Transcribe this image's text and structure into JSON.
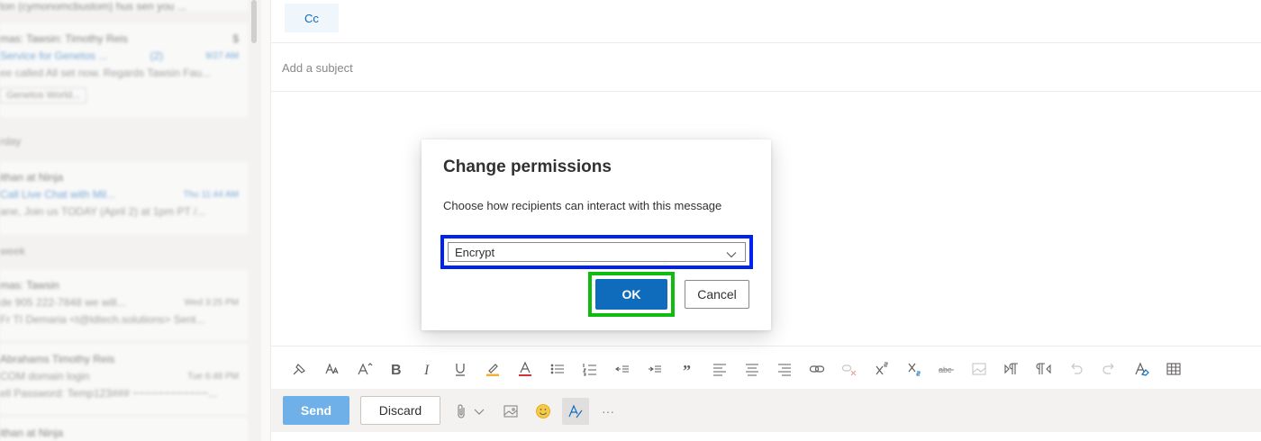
{
  "mail_list": {
    "items": [
      {
        "sender": "ton (cymonomcbustom) hus sen you ...",
        "subject": "",
        "preview": "",
        "time": ""
      },
      {
        "sender": "mas: Tawsin: Timothy Reis",
        "subject": "Service for Genetos ...",
        "preview": "ee called All set now. Regards Tawsin Fau...",
        "time": "9/27 AM",
        "count": "(2)",
        "chip": "Genetos World..."
      },
      {
        "sender": "ithan at Ninja",
        "subject": "Call Live Chat with Mil...",
        "preview": "ane, Join us TODAY (April 2) at 1pm PT /...",
        "time": "Thu 11:44 AM"
      },
      {
        "sender": "mas: Tawsin",
        "subject": "de 905 222-7848 we will...",
        "preview": "Fr TI Demaria <t@ldtech.solutions> Sent...",
        "time": "Wed 3:25 PM"
      },
      {
        "sender": "Abrahams Timothy Reis",
        "subject": "COM domain login",
        "preview": "ell Password: Temp123### ~~~~~~~~~~~~...",
        "time": "Tue 6:48 PM"
      },
      {
        "sender": "ithan at Ninja",
        "subject": "",
        "preview": "",
        "time": ""
      }
    ],
    "groups": [
      "rday",
      "week"
    ]
  },
  "compose": {
    "cc_label": "Cc",
    "subject_placeholder": "Add a subject",
    "send_label": "Send",
    "discard_label": "Discard",
    "more_label": "···"
  },
  "format_icons": [
    "format-painter-icon",
    "font-size-icon",
    "grow-font-icon",
    "bold-icon",
    "italic-icon",
    "underline-icon",
    "highlight-icon",
    "font-color-icon",
    "bullets-icon",
    "numbering-icon",
    "decrease-indent-icon",
    "increase-indent-icon",
    "quote-icon",
    "align-left-icon",
    "align-center-icon",
    "align-right-icon",
    "insert-link-icon",
    "remove-link-icon",
    "superscript-icon",
    "subscript-icon",
    "strikethrough-icon",
    "insert-picture-icon",
    "ltr-icon",
    "rtl-icon",
    "undo-icon",
    "redo-icon",
    "clear-format-icon",
    "insert-table-icon"
  ],
  "dialog": {
    "title": "Change permissions",
    "description": "Choose how recipients can interact with this message",
    "selected_option": "Encrypt",
    "ok_label": "OK",
    "cancel_label": "Cancel"
  },
  "colors": {
    "accent": "#0f6cbd",
    "send_disabled": "#6fb0e8",
    "select_highlight": "#0022ee",
    "ok_highlight": "#11bb11"
  }
}
